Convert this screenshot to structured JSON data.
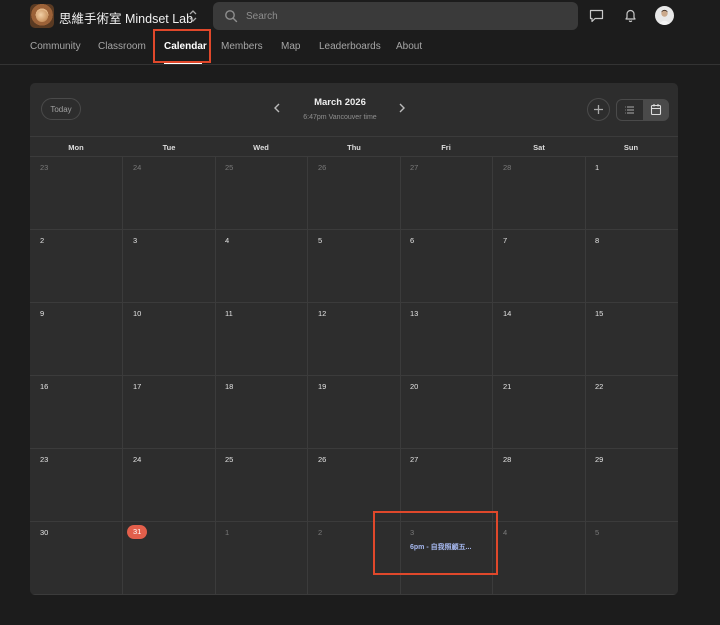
{
  "header": {
    "brand": "思維手術室 Mindset Lab",
    "search_placeholder": "Search"
  },
  "nav": {
    "items": [
      "Community",
      "Classroom",
      "Calendar",
      "Members",
      "Map",
      "Leaderboards",
      "About"
    ],
    "active": "Calendar"
  },
  "calendar": {
    "today_label": "Today",
    "month_title": "March 2026",
    "time_subtitle": "6:47pm Vancouver time",
    "weekdays": [
      "Mon",
      "Tue",
      "Wed",
      "Thu",
      "Fri",
      "Sat",
      "Sun"
    ],
    "weeks": [
      [
        "23",
        "24",
        "25",
        "26",
        "27",
        "28",
        "1"
      ],
      [
        "2",
        "3",
        "4",
        "5",
        "6",
        "7",
        "8"
      ],
      [
        "9",
        "10",
        "11",
        "12",
        "13",
        "14",
        "15"
      ],
      [
        "16",
        "17",
        "18",
        "19",
        "20",
        "21",
        "22"
      ],
      [
        "23",
        "24",
        "25",
        "26",
        "27",
        "28",
        "29"
      ],
      [
        "30",
        "31",
        "1",
        "2",
        "3",
        "4",
        "5"
      ]
    ],
    "today": "31",
    "event": "6pm - 自我照顧五..."
  },
  "colors": {
    "highlight": "#e0482b",
    "today_badge": "#e25f4b",
    "event_text": "#a7b9f0"
  }
}
